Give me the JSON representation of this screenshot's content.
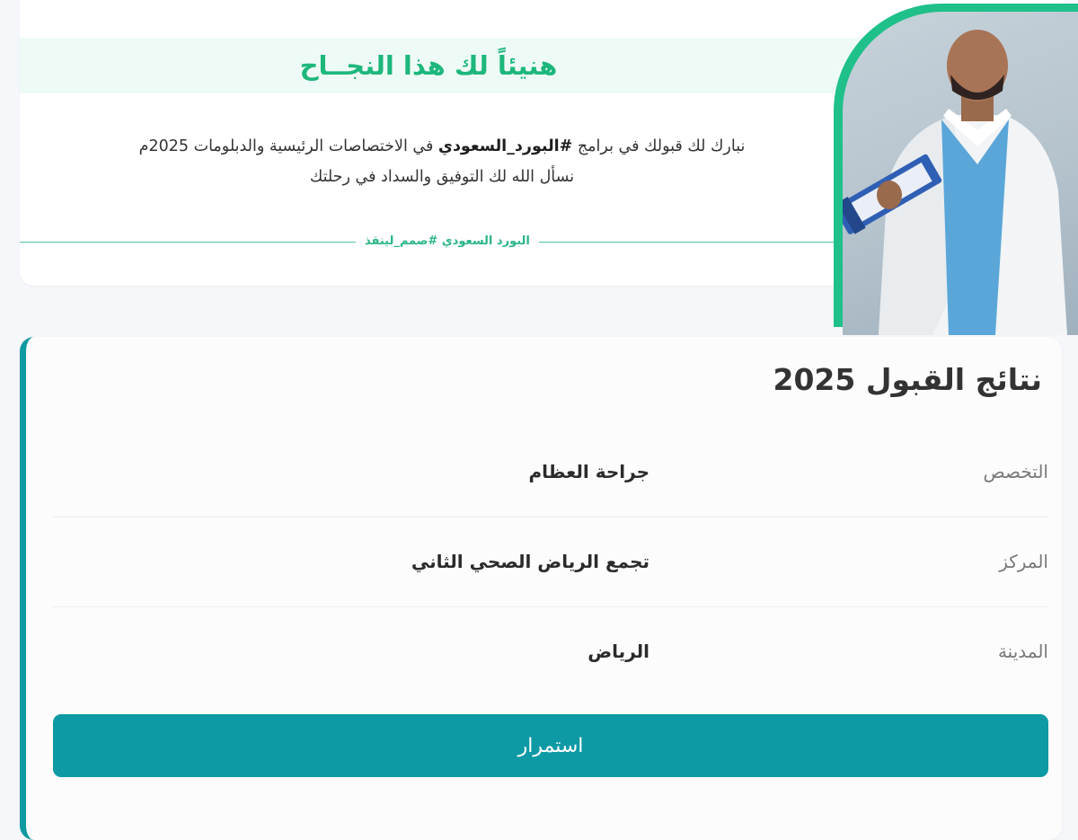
{
  "banner": {
    "heading": "هنيئاً لك هذا النجــاح",
    "line1_prefix": "نبارك لك قبولك في برامج ",
    "line1_hashtag": "#البورد_السعودي",
    "line1_suffix": " في الاختصاصات الرئيسية والدبلومات 2025م",
    "line2": "نسأل الله لك التوفيق والسداد في رحلتك",
    "signature": "البورد السعودي #صمم_لينقذ",
    "accent_color": "#1db77c"
  },
  "result": {
    "title": "نتائج القبول 2025",
    "rows": [
      {
        "label": "التخصص",
        "value": "جراحة العظام"
      },
      {
        "label": "المركز",
        "value": "تجمع الرياض الصحي الثاني"
      },
      {
        "label": "المدينة",
        "value": "الرياض"
      }
    ],
    "continue_label": "استمرار",
    "accent_color": "#0e9aa5"
  }
}
